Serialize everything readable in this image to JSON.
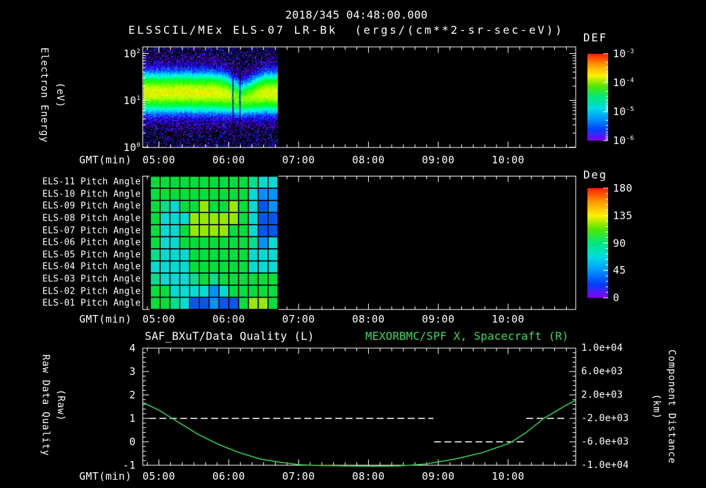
{
  "header": {
    "timestamp": "2018/345 04:48:00.000",
    "title": "ELSSCIL/MEx ELS-07 LR-Bk  (ergs/(cm**2-sr-sec-eV))"
  },
  "colors": {
    "background": "#000000",
    "axis": "#ffffff",
    "text": "#ffffff",
    "title_green": "#3fdb63",
    "curve_green": "#2ec94e",
    "rainbow_top_to_bottom": [
      "#ff1e00",
      "#ff9800",
      "#fff000",
      "#50e800",
      "#00e87c",
      "#00dce0",
      "#0096ff",
      "#0040ff",
      "#8800f0"
    ]
  },
  "time_axis": {
    "label": "GMT(min)",
    "ticks": [
      "05:00",
      "06:00",
      "07:00",
      "08:00",
      "09:00",
      "10:00"
    ],
    "tick_hours": [
      5,
      6,
      7,
      8,
      9,
      10
    ],
    "start_hour": 4.768,
    "end_hour": 10.967,
    "minor_step_minutes": 10
  },
  "spectrogram_panel": {
    "ylabel": "Electron Energy",
    "ylabel2": "(eV)",
    "ytick_base": "10",
    "ytick_exponents": [
      2,
      1,
      0
    ],
    "colorbar": {
      "title": "DEF",
      "base": "10",
      "tick_exponents": [
        -3,
        -4,
        -5,
        -6
      ]
    }
  },
  "pitch_panel": {
    "row_labels": [
      "ELS-11 Pitch Angle",
      "ELS-10 Pitch Angle",
      "ELS-09 Pitch Angle",
      "ELS-08 Pitch Angle",
      "ELS-07 Pitch Angle",
      "ELS-06 Pitch Angle",
      "ELS-05 Pitch Angle",
      "ELS-04 Pitch Angle",
      "ELS-03 Pitch Angle",
      "ELS-02 Pitch Angle",
      "ELS-01 Pitch Angle"
    ],
    "colorbar": {
      "title": "Deg",
      "ticks": [
        180,
        135,
        90,
        45,
        0
      ]
    },
    "palette": {
      "G": "#00e03c",
      "Y": "#96e800",
      "T": "#00e08c",
      "C": "#00dcd4",
      "L": "#0092ff",
      "B": "#0058f0"
    },
    "grid_colors": [
      [
        "G",
        "G",
        "G",
        "G",
        "G",
        "G",
        "G",
        "G",
        "G",
        "G",
        "T",
        "C",
        "C"
      ],
      [
        "G",
        "G",
        "G",
        "G",
        "G",
        "G",
        "G",
        "G",
        "G",
        "G",
        "C",
        "L",
        "L"
      ],
      [
        "G",
        "T",
        "C",
        "G",
        "G",
        "Y",
        "G",
        "G",
        "Y",
        "G",
        "C",
        "B",
        "L"
      ],
      [
        "G",
        "C",
        "C",
        "C",
        "Y",
        "Y",
        "Y",
        "Y",
        "Y",
        "G",
        "C",
        "B",
        "B"
      ],
      [
        "G",
        "C",
        "C",
        "G",
        "Y",
        "Y",
        "Y",
        "Y",
        "G",
        "G",
        "C",
        "B",
        "B"
      ],
      [
        "G",
        "C",
        "C",
        "G",
        "G",
        "G",
        "G",
        "G",
        "G",
        "G",
        "T",
        "L",
        "C"
      ],
      [
        "T",
        "C",
        "C",
        "C",
        "G",
        "G",
        "G",
        "G",
        "G",
        "G",
        "C",
        "C",
        "C"
      ],
      [
        "C",
        "C",
        "C",
        "C",
        "G",
        "G",
        "G",
        "G",
        "G",
        "G",
        "C",
        "C",
        "C"
      ],
      [
        "T",
        "C",
        "C",
        "C",
        "T",
        "G",
        "T",
        "G",
        "G",
        "G",
        "G",
        "G",
        "G"
      ],
      [
        "G",
        "G",
        "C",
        "C",
        "C",
        "C",
        "L",
        "C",
        "G",
        "G",
        "G",
        "G",
        "G"
      ],
      [
        "G",
        "G",
        "T",
        "C",
        "B",
        "B",
        "L",
        "B",
        "B",
        "G",
        "Y",
        "Y",
        "G"
      ]
    ]
  },
  "bottom_panel": {
    "title_left": "SAF_BXuT/Data Quality (L)",
    "title_right": "MEXORBMC/SPF X, Spacecraft (R)",
    "ylabel_left": "Raw Data Quality",
    "ylabel_left2": "(Raw)",
    "yticks_left": [
      4,
      3,
      2,
      1,
      0,
      -1
    ],
    "ylabel_right": "Component Distance",
    "ylabel_right2": "(km)",
    "yticks_right": [
      "1.0e+04",
      "6.0e+03",
      "2.0e+03",
      "-2.0e+03",
      "-6.0e+03",
      "-1.0e+04"
    ],
    "ylim_left": [
      -1,
      4
    ],
    "ylim_right": [
      -10000,
      10000
    ]
  },
  "chart_data": [
    {
      "type": "heatmap",
      "name": "electron-energy-spectrogram",
      "title": "ELSSCIL/MEx ELS-07 LR-Bk",
      "units": "ergs/(cm**2-sr-sec-eV)",
      "x_range_hours": [
        4.77,
        6.7
      ],
      "y_range_ev": [
        1,
        135
      ],
      "y_scale": "log",
      "z_log10_flux_range": [
        -6,
        -3
      ],
      "band_model": {
        "center_ev": 15,
        "center_log10_ev": 1.17,
        "sigma_log10_ev": 0.34,
        "peak_log10_flux": -3.72,
        "background_log10_flux": -6.6,
        "dip_hour": 6.2,
        "dip_center_drop_log10": 0.13,
        "dropout_hours": [
          6.055,
          6.155
        ]
      }
    },
    {
      "type": "heatmap",
      "name": "pitch-angle-grid",
      "rows": [
        "ELS-11",
        "ELS-10",
        "ELS-09",
        "ELS-08",
        "ELS-07",
        "ELS-06",
        "ELS-05",
        "ELS-04",
        "ELS-03",
        "ELS-02",
        "ELS-01"
      ],
      "columns": 13,
      "x_range_hours": [
        4.87,
        6.7
      ],
      "value_scale_deg": [
        0,
        180
      ],
      "color_to_deg": {
        "G": 105,
        "Y": 125,
        "T": 92,
        "C": 75,
        "L": 50,
        "B": 35
      }
    },
    {
      "type": "line",
      "name": "quality-and-spacecraft-x",
      "xlabel": "GMT(min)",
      "ylim_left": [
        -1,
        4
      ],
      "ylim_right": [
        -10000,
        10000
      ],
      "series": [
        {
          "name": "SAF_BXuT/Data Quality (L)",
          "axis": "left",
          "style": "dashed-white",
          "segments": [
            {
              "start_hour": 4.86,
              "end_hour": 8.93,
              "value": 1
            },
            {
              "start_hour": 8.94,
              "end_hour": 10.25,
              "value": 0
            },
            {
              "start_hour": 10.26,
              "end_hour": 10.82,
              "value": 1
            }
          ]
        },
        {
          "name": "MEXORBMC/SPF X, Spacecraft (R)",
          "axis": "right",
          "style": "solid-green",
          "points_hour_km": [
            [
              4.77,
              720
            ],
            [
              5.0,
              -600
            ],
            [
              5.27,
              -2600
            ],
            [
              5.56,
              -4720
            ],
            [
              5.86,
              -6480
            ],
            [
              6.16,
              -7880
            ],
            [
              6.46,
              -8960
            ],
            [
              6.75,
              -9520
            ],
            [
              7.0,
              -9880
            ],
            [
              7.25,
              -10040
            ],
            [
              7.64,
              -10120
            ],
            [
              8.04,
              -10160
            ],
            [
              8.44,
              -10120
            ],
            [
              8.83,
              -9760
            ],
            [
              9.23,
              -8960
            ],
            [
              9.62,
              -7880
            ],
            [
              10.02,
              -6240
            ],
            [
              10.25,
              -4480
            ],
            [
              10.51,
              -2000
            ],
            [
              10.81,
              120
            ],
            [
              10.96,
              1040
            ]
          ]
        }
      ]
    }
  ]
}
